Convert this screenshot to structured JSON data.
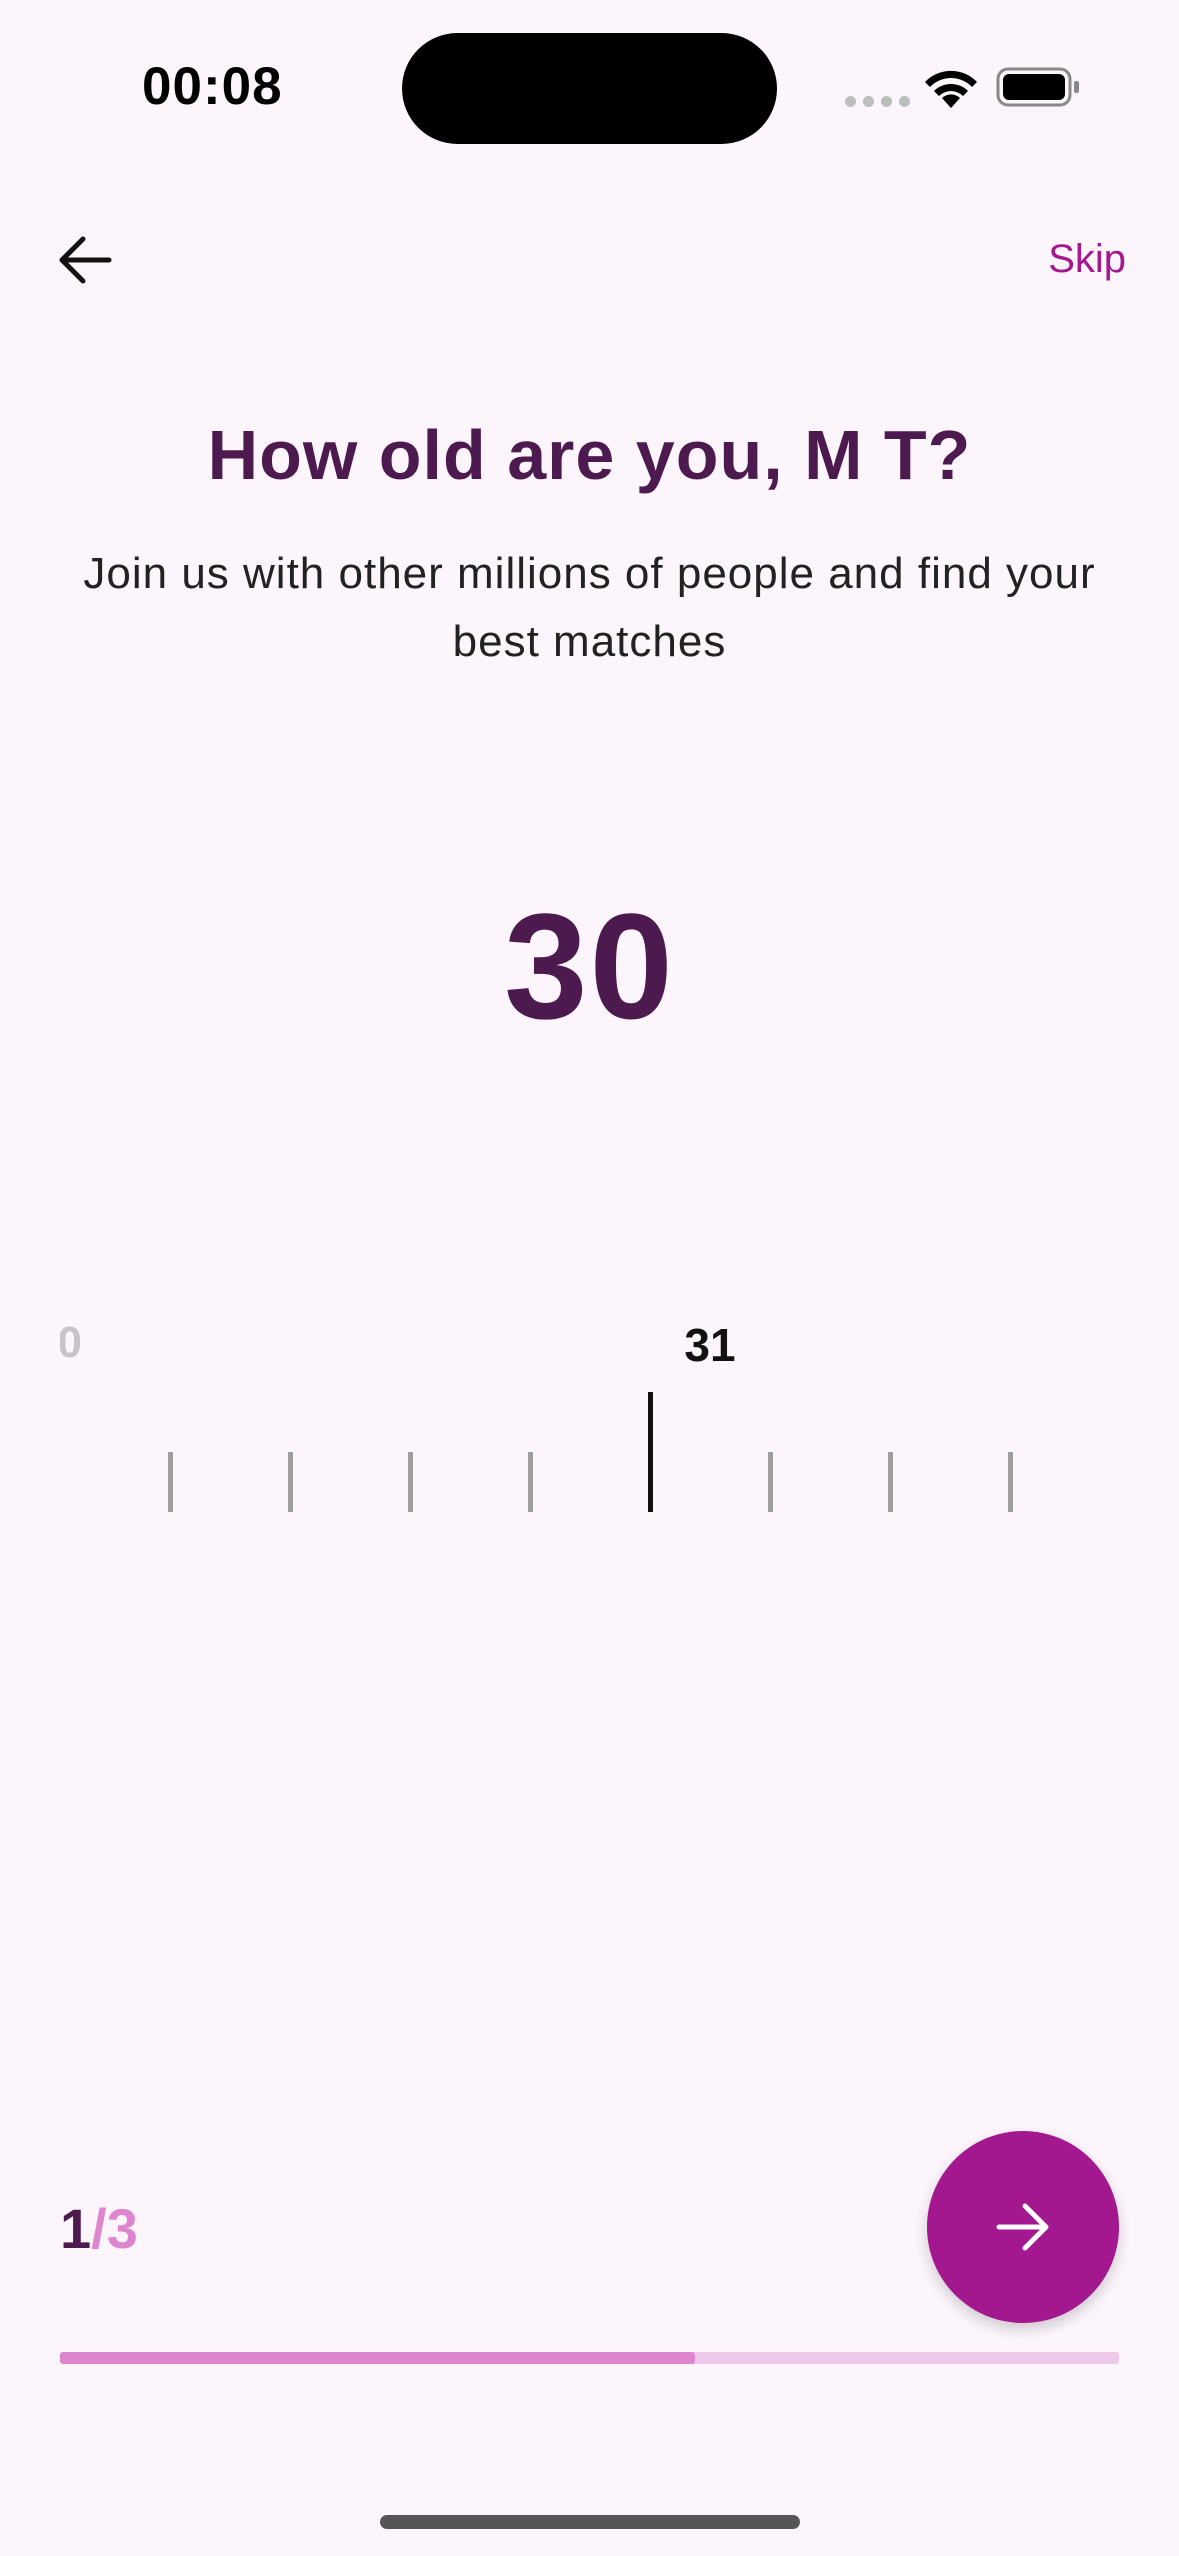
{
  "status_bar": {
    "time": "00:08"
  },
  "nav": {
    "skip_label": "Skip"
  },
  "heading": {
    "title": "How old are you, M T?",
    "subtitle": "Join us with other millions of people and find your best matches"
  },
  "age_picker": {
    "selected_value": "30",
    "visible_labels": {
      "left_partial": "0",
      "center": "31"
    }
  },
  "pager": {
    "current": "1",
    "separator": "/",
    "total": "3",
    "progress": 0.6
  },
  "colors": {
    "background": "#FCF5FC",
    "title": "#4C1A4E",
    "accent": "#A3188F",
    "progress_fill": "#DE85CF",
    "progress_track": "#EEC9EA"
  },
  "icons": {
    "back": "arrow-left-icon",
    "next": "arrow-right-icon",
    "wifi": "wifi-icon",
    "battery": "battery-icon",
    "signal": "cellular-signal-icon"
  }
}
